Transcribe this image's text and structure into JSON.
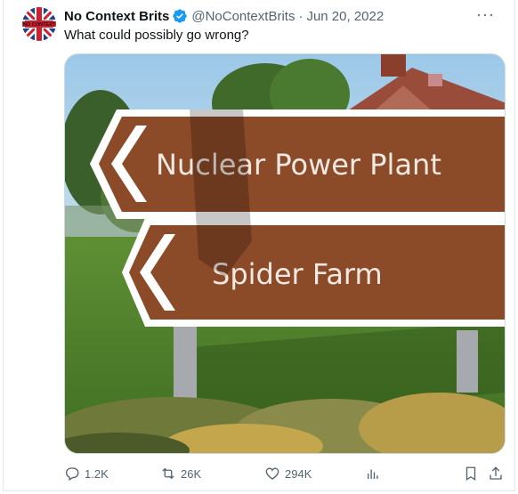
{
  "tweet": {
    "author_name": "No Context Brits",
    "handle": "@NoContextBrits",
    "separator": "·",
    "date": "Jun 20, 2022",
    "more_label": "···",
    "text": "What could possibly go wrong?",
    "avatar_text": "NO CONTEXT"
  },
  "image": {
    "sign_top": "Nuclear Power Plant",
    "sign_bottom": "Spider Farm"
  },
  "actions": {
    "replies": "1.2K",
    "reposts": "26K",
    "likes": "294K"
  },
  "icons": {
    "verified": "verified-badge-icon",
    "reply": "reply-icon",
    "repost": "repost-icon",
    "like": "heart-icon",
    "views": "views-chart-icon",
    "bookmark": "bookmark-icon",
    "share": "share-icon",
    "more": "more-dots-icon"
  },
  "colors": {
    "brand_blue": "#1d9bf0",
    "text_secondary": "#536471",
    "sign_brown": "#8b4a28"
  }
}
